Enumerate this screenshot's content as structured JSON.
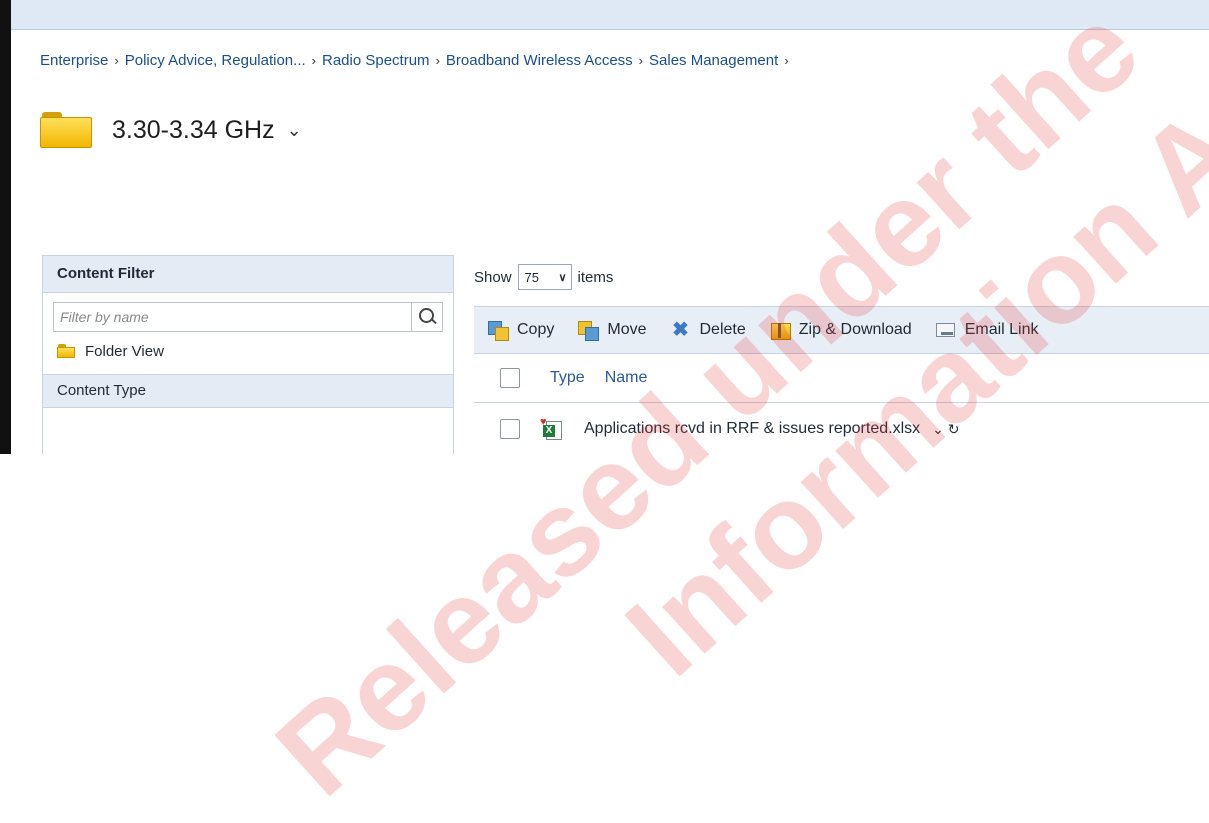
{
  "breadcrumb": {
    "items": [
      "Enterprise",
      "Policy Advice, Regulation...",
      "Radio Spectrum",
      "Broadband Wireless Access",
      "Sales Management"
    ],
    "separator": "›"
  },
  "folder": {
    "title": "3.30-3.34 GHz",
    "chevron": "⌄"
  },
  "filter_panel": {
    "header": "Content Filter",
    "search_placeholder": "Filter by name",
    "folder_view_label": "Folder View",
    "content_type_label": "Content Type"
  },
  "list_controls": {
    "show_label": "Show",
    "page_size": "75",
    "items_label": "items"
  },
  "toolbar": {
    "copy_label": "Copy",
    "move_label": "Move",
    "delete_label": "Delete",
    "zip_label": "Zip & Download",
    "email_label": "Email Link"
  },
  "table": {
    "columns": [
      "Type",
      "Name"
    ],
    "rows": [
      {
        "type_icon": "excel-file-icon",
        "name": "Applications rcvd in RRF & issues reported.xlsx",
        "actions": "⌄ ↻"
      }
    ]
  },
  "watermark": {
    "line1": "Released under the",
    "line2": "Information Act"
  },
  "colors": {
    "header_bg": "#e3ebf5",
    "link": "#1a4f8b",
    "folder": "#f2b600"
  }
}
